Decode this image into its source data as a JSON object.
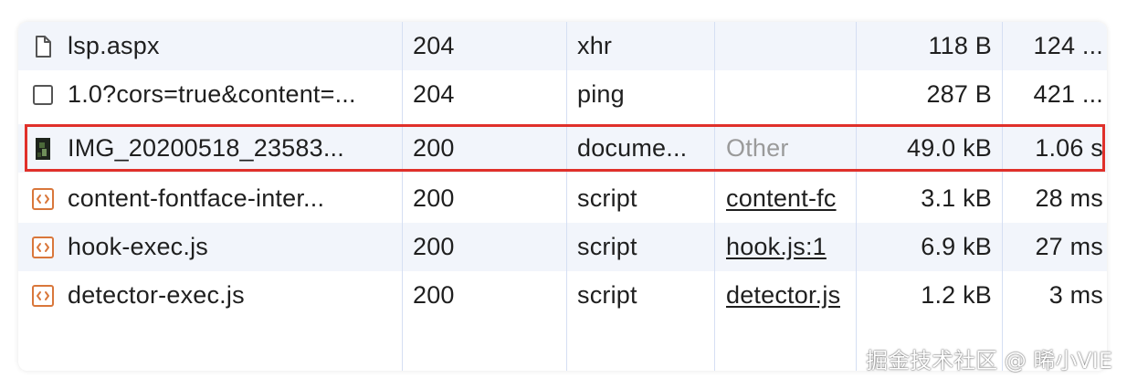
{
  "requests": [
    {
      "name": "lsp.aspx",
      "status": "204",
      "type": "xhr",
      "initiator": "",
      "size": "118 B",
      "time": "124 ...",
      "icon": "document-icon"
    },
    {
      "name": "1.0?cors=true&content=...",
      "status": "204",
      "type": "ping",
      "initiator": "",
      "size": "287 B",
      "time": "421 ...",
      "icon": "checkbox-icon"
    },
    {
      "name": "IMG_20200518_23583...",
      "status": "200",
      "type": "docume...",
      "initiator": "Other",
      "size": "49.0 kB",
      "time": "1.06 s",
      "icon": "image-thumbnail-icon"
    },
    {
      "name": "content-fontface-inter...",
      "status": "200",
      "type": "script",
      "initiator": "content-fc",
      "size": "3.1 kB",
      "time": "28 ms",
      "icon": "script-icon"
    },
    {
      "name": "hook-exec.js",
      "status": "200",
      "type": "script",
      "initiator": "hook.js:1",
      "size": "6.9 kB",
      "time": "27 ms",
      "icon": "script-icon"
    },
    {
      "name": "detector-exec.js",
      "status": "200",
      "type": "script",
      "initiator": "detector.js",
      "size": "1.2 kB",
      "time": "3 ms",
      "icon": "script-icon"
    }
  ],
  "highlighted_row": 2,
  "watermark": "掘金技术社区 @ 晞小VIE",
  "colors": {
    "alt_row": "#f2f5fb",
    "highlight_border": "#e0302a",
    "script_icon": "#d9773b",
    "grid_line": "#d5dff3"
  }
}
